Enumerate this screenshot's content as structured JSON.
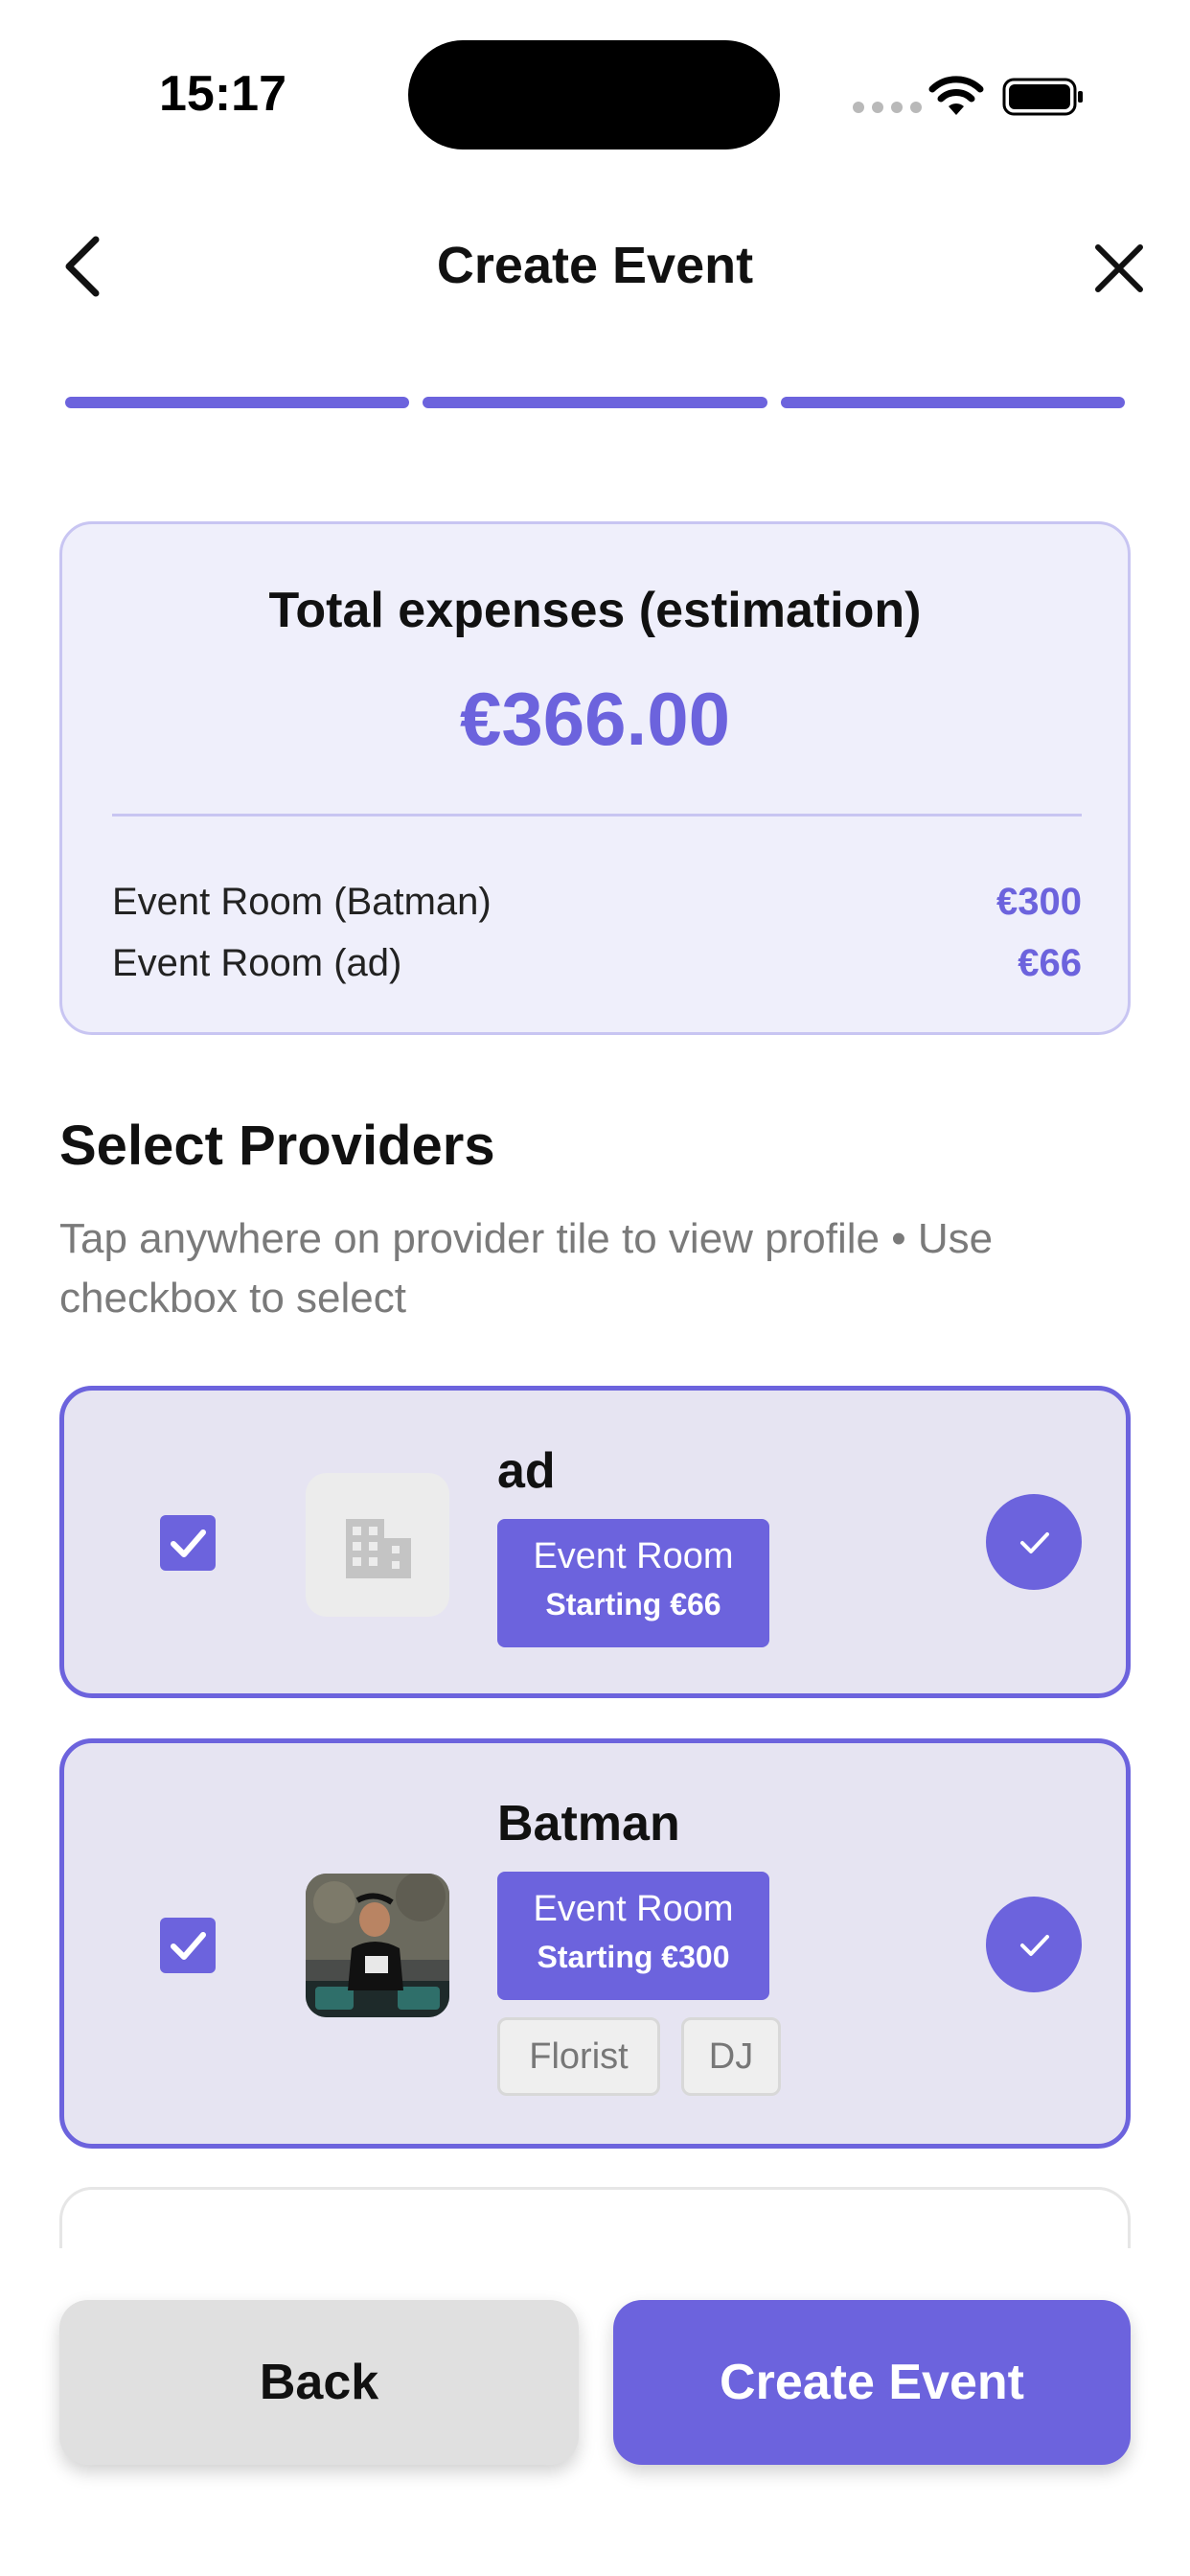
{
  "status_bar": {
    "time": "15:17"
  },
  "header": {
    "title": "Create Event"
  },
  "progress": {
    "steps_total": 3,
    "steps_completed": 3
  },
  "expenses": {
    "title": "Total expenses (estimation)",
    "total": "€366.00",
    "items": [
      {
        "name": "Event Room (Batman)",
        "amount": "€300"
      },
      {
        "name": "Event Room (ad)",
        "amount": "€66"
      }
    ]
  },
  "providers_section": {
    "title": "Select Providers",
    "subtitle": "Tap anywhere on provider tile to view profile • Use checkbox to select"
  },
  "providers": [
    {
      "name": "ad",
      "selected": true,
      "primary_service": {
        "label": "Event Room",
        "price": "Starting €66"
      },
      "other_services": []
    },
    {
      "name": "Batman",
      "selected": true,
      "primary_service": {
        "label": "Event Room",
        "price": "Starting €300"
      },
      "other_services": [
        "Florist",
        "DJ"
      ]
    }
  ],
  "actions": {
    "back_label": "Back",
    "create_label": "Create Event"
  },
  "colors": {
    "accent": "#6c63dd",
    "card_bg": "#efeffb",
    "selected_card_bg": "#e6e4f2"
  }
}
